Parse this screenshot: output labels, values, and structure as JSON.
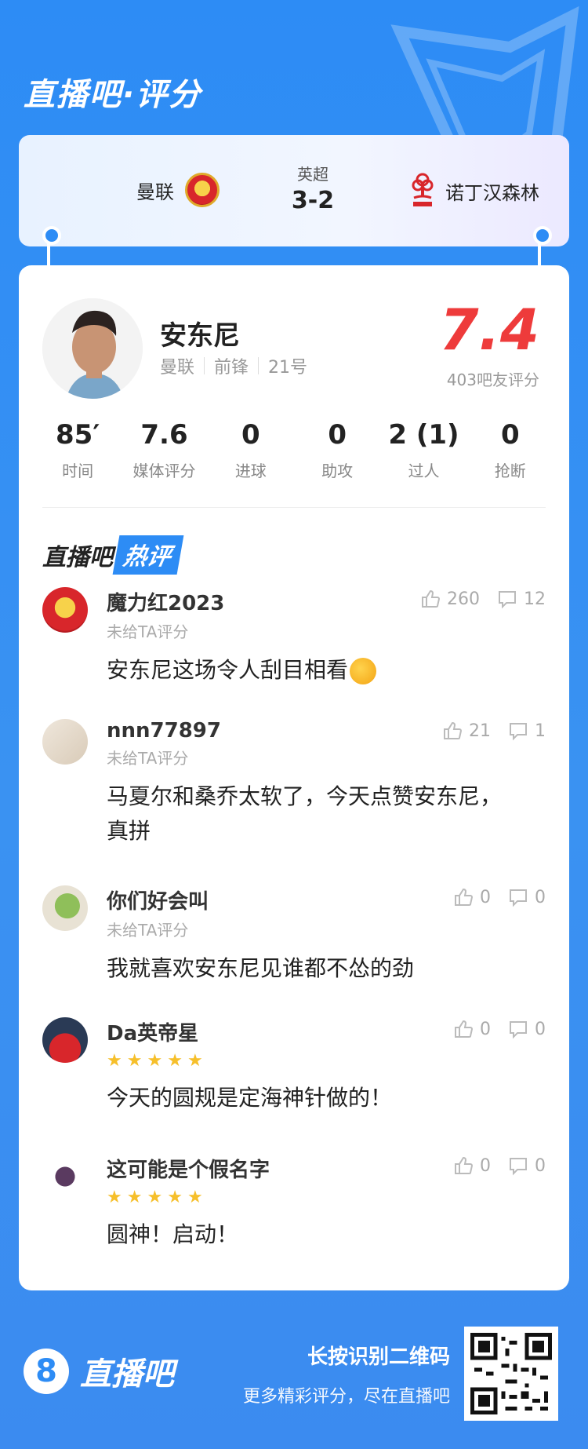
{
  "header": {
    "title": "直播吧·评分"
  },
  "match": {
    "home_team": "曼联",
    "away_team": "诺丁汉森林",
    "league": "英超",
    "score": "3-2"
  },
  "player": {
    "name": "安东尼",
    "team": "曼联",
    "position": "前锋",
    "number": "21号",
    "rating": "7.4",
    "rating_count": "403吧友评分"
  },
  "stats": [
    {
      "value": "85′",
      "label": "时间"
    },
    {
      "value": "7.6",
      "label": "媒体评分"
    },
    {
      "value": "0",
      "label": "进球"
    },
    {
      "value": "0",
      "label": "助攻"
    },
    {
      "value": "2 (1)",
      "label": "过人"
    },
    {
      "value": "0",
      "label": "抢断"
    }
  ],
  "hot_section": {
    "title_a": "直播吧",
    "title_b": "热评"
  },
  "comments": [
    {
      "user": "魔力红2023",
      "sub": "未给TA评分",
      "likes": "260",
      "replies": "12",
      "text": "安东尼这场令人刮目相看",
      "stars": 0,
      "emoji": "thinking-face-emoji",
      "avatar": "mu-crest-avatar"
    },
    {
      "user": "nnn77897",
      "sub": "未给TA评分",
      "likes": "21",
      "replies": "1",
      "text": "马夏尔和桑乔太软了，今天点赞安东尼，真拼",
      "stars": 0,
      "avatar": "paper-avatar"
    },
    {
      "user": "你们好会叫",
      "sub": "未给TA评分",
      "likes": "0",
      "replies": "0",
      "text": "我就喜欢安东尼见谁都不怂的劲",
      "stars": 0,
      "avatar": "cartoon-avatar"
    },
    {
      "user": "Da英帝星",
      "sub": "",
      "likes": "0",
      "replies": "0",
      "text": "今天的圆规是定海神针做的！",
      "stars": 5,
      "avatar": "player-shirt-avatar"
    },
    {
      "user": "这可能是个假名字",
      "sub": "",
      "likes": "0",
      "replies": "0",
      "text": "圆神！启动！",
      "stars": 5,
      "avatar": "monster-avatar"
    }
  ],
  "footer": {
    "logo_number": "8",
    "logo_text": "直播吧",
    "line1": "长按识别二维码",
    "line2": "更多精彩评分，尽在直播吧"
  },
  "colors": {
    "brand_blue": "#2d8cf5",
    "rating_red": "#ee3b3b",
    "star": "#f6bf2a"
  }
}
